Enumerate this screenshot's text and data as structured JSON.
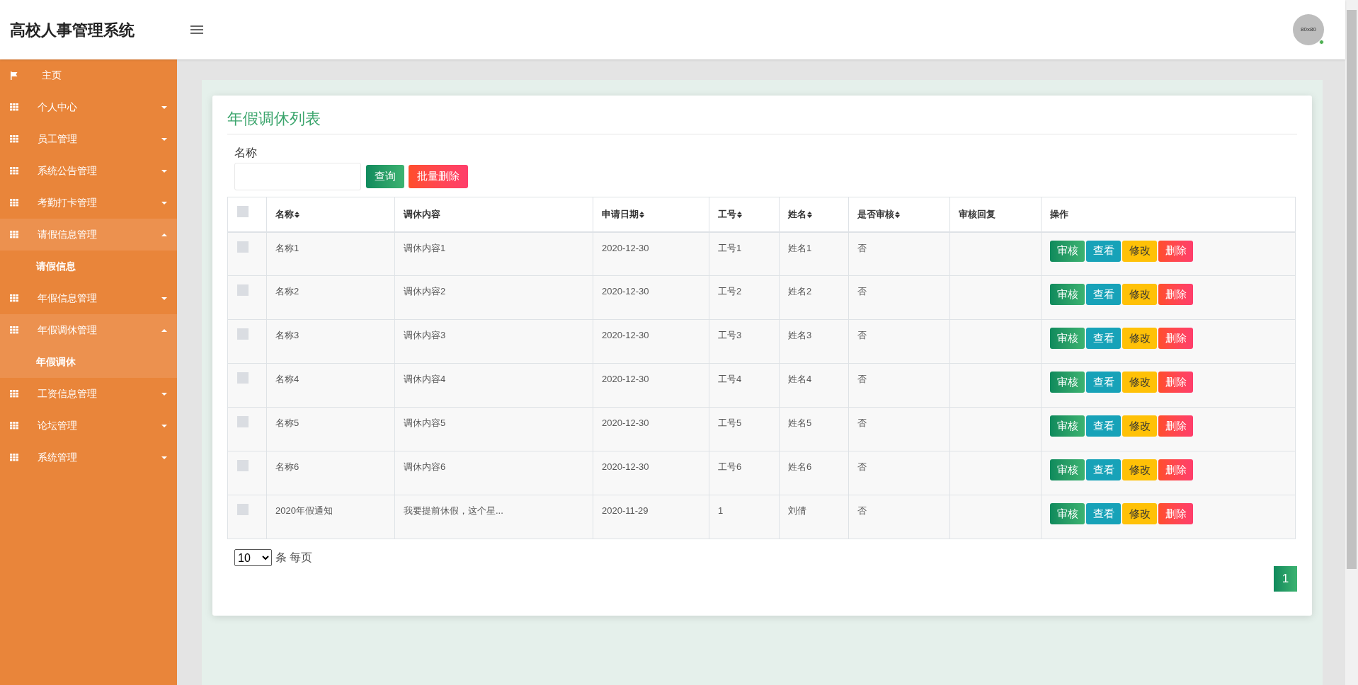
{
  "header": {
    "title": "高校人事管理系统",
    "avatar_text": "80x80",
    "online": true
  },
  "sidebar": {
    "items": [
      {
        "label": "主页",
        "kind": "link"
      },
      {
        "label": "个人中心",
        "kind": "menu",
        "expanded": false
      },
      {
        "label": "员工管理",
        "kind": "menu",
        "expanded": false
      },
      {
        "label": "系统公告管理",
        "kind": "menu",
        "expanded": false
      },
      {
        "label": "考勤打卡管理",
        "kind": "menu",
        "expanded": false
      },
      {
        "label": "请假信息管理",
        "kind": "menu",
        "expanded": true,
        "children": [
          {
            "label": "请假信息",
            "selected": false
          }
        ]
      },
      {
        "label": "年假信息管理",
        "kind": "menu",
        "expanded": false
      },
      {
        "label": "年假调休管理",
        "kind": "menu",
        "expanded": true,
        "children": [
          {
            "label": "年假调休",
            "selected": true
          }
        ]
      },
      {
        "label": "工资信息管理",
        "kind": "menu",
        "expanded": false
      },
      {
        "label": "论坛管理",
        "kind": "menu",
        "expanded": false
      },
      {
        "label": "系统管理",
        "kind": "menu",
        "expanded": false
      }
    ]
  },
  "card": {
    "title": "年假调休列表",
    "search": {
      "label": "名称",
      "buttons": [
        {
          "label": "查询",
          "kind": "primary"
        },
        {
          "label": "批量删除",
          "kind": "danger"
        }
      ]
    },
    "table": {
      "select_all_checked": false,
      "columns": [
        {
          "label": "名称",
          "sortable": true
        },
        {
          "label": "调休内容",
          "sortable": false
        },
        {
          "label": "申请日期",
          "sortable": true
        },
        {
          "label": "工号",
          "sortable": true
        },
        {
          "label": "姓名",
          "sortable": true
        },
        {
          "label": "是否审核",
          "sortable": true
        },
        {
          "label": "审核回复",
          "sortable": false
        },
        {
          "label": "操作",
          "sortable": false
        }
      ],
      "rows": [
        {
          "checked": false,
          "cells": [
            "名称1",
            "调休内容1",
            "2020-12-30",
            "工号1",
            "姓名1",
            "否",
            ""
          ],
          "actions": [
            {
              "label": "审核",
              "kind": "approve"
            },
            {
              "label": "查看",
              "kind": "view"
            },
            {
              "label": "修改",
              "kind": "edit"
            },
            {
              "label": "删除",
              "kind": "delete"
            }
          ]
        },
        {
          "checked": false,
          "cells": [
            "名称2",
            "调休内容2",
            "2020-12-30",
            "工号2",
            "姓名2",
            "否",
            ""
          ],
          "actions": [
            {
              "label": "审核",
              "kind": "approve"
            },
            {
              "label": "查看",
              "kind": "view"
            },
            {
              "label": "修改",
              "kind": "edit"
            },
            {
              "label": "删除",
              "kind": "delete"
            }
          ]
        },
        {
          "checked": false,
          "cells": [
            "名称3",
            "调休内容3",
            "2020-12-30",
            "工号3",
            "姓名3",
            "否",
            ""
          ],
          "actions": [
            {
              "label": "审核",
              "kind": "approve"
            },
            {
              "label": "查看",
              "kind": "view"
            },
            {
              "label": "修改",
              "kind": "edit"
            },
            {
              "label": "删除",
              "kind": "delete"
            }
          ]
        },
        {
          "checked": false,
          "cells": [
            "名称4",
            "调休内容4",
            "2020-12-30",
            "工号4",
            "姓名4",
            "否",
            ""
          ],
          "actions": [
            {
              "label": "审核",
              "kind": "approve"
            },
            {
              "label": "查看",
              "kind": "view"
            },
            {
              "label": "修改",
              "kind": "edit"
            },
            {
              "label": "删除",
              "kind": "delete"
            }
          ]
        },
        {
          "checked": false,
          "cells": [
            "名称5",
            "调休内容5",
            "2020-12-30",
            "工号5",
            "姓名5",
            "否",
            ""
          ],
          "actions": [
            {
              "label": "审核",
              "kind": "approve"
            },
            {
              "label": "查看",
              "kind": "view"
            },
            {
              "label": "修改",
              "kind": "edit"
            },
            {
              "label": "删除",
              "kind": "delete"
            }
          ]
        },
        {
          "checked": false,
          "cells": [
            "名称6",
            "调休内容6",
            "2020-12-30",
            "工号6",
            "姓名6",
            "否",
            ""
          ],
          "actions": [
            {
              "label": "审核",
              "kind": "approve"
            },
            {
              "label": "查看",
              "kind": "view"
            },
            {
              "label": "修改",
              "kind": "edit"
            },
            {
              "label": "删除",
              "kind": "delete"
            }
          ]
        },
        {
          "checked": false,
          "cells": [
            "2020年假通知",
            "我要提前休假，这个星...",
            "2020-11-29",
            "1",
            "刘倩",
            "否",
            ""
          ],
          "actions": [
            {
              "label": "审核",
              "kind": "approve"
            },
            {
              "label": "查看",
              "kind": "view"
            },
            {
              "label": "修改",
              "kind": "edit"
            },
            {
              "label": "删除",
              "kind": "delete"
            }
          ]
        }
      ]
    },
    "pagination": {
      "page_size": "10",
      "page_size_label": "条 每页",
      "pages": [
        {
          "label": "1",
          "selected": true
        }
      ]
    }
  }
}
